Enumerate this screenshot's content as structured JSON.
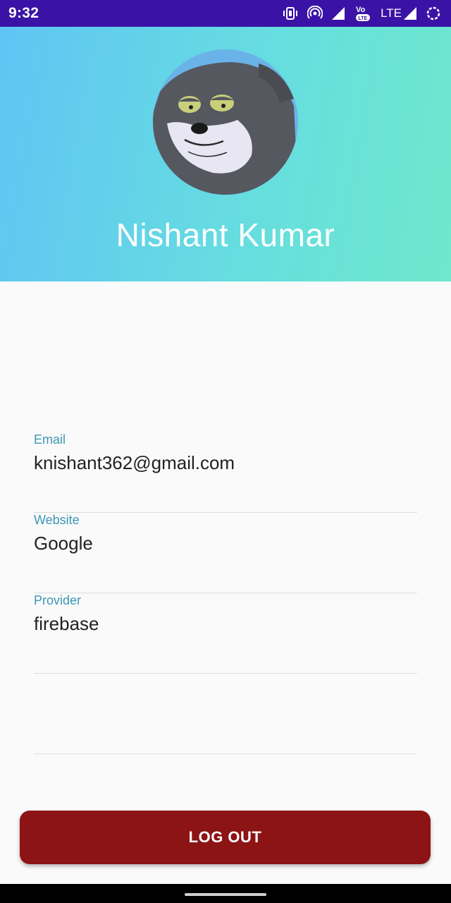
{
  "colors": {
    "status_bar": "#3a13a6",
    "header_gradient_start": "#5fc4f4",
    "header_gradient_end": "#6de8cc",
    "label": "#3d96b5",
    "value": "#222222",
    "divider": "#dcdcdc",
    "logout_button": "#8c1414",
    "background": "#fafafa"
  },
  "status_bar": {
    "time": "9:32",
    "network_label": "LTE",
    "icons": [
      "vibrate-icon",
      "hotspot-icon",
      "signal-icon",
      "volte-icon",
      "signal-icon",
      "loading-ring-icon"
    ]
  },
  "profile": {
    "name": "Nishant Kumar",
    "avatar": "cartoon-cat-avatar"
  },
  "fields": [
    {
      "label": "Email",
      "value": "knishant362@gmail.com"
    },
    {
      "label": "Website",
      "value": "Google"
    },
    {
      "label": "Provider",
      "value": "firebase"
    },
    {
      "label": "",
      "value": ""
    }
  ],
  "actions": {
    "logout_label": "LOG OUT"
  }
}
